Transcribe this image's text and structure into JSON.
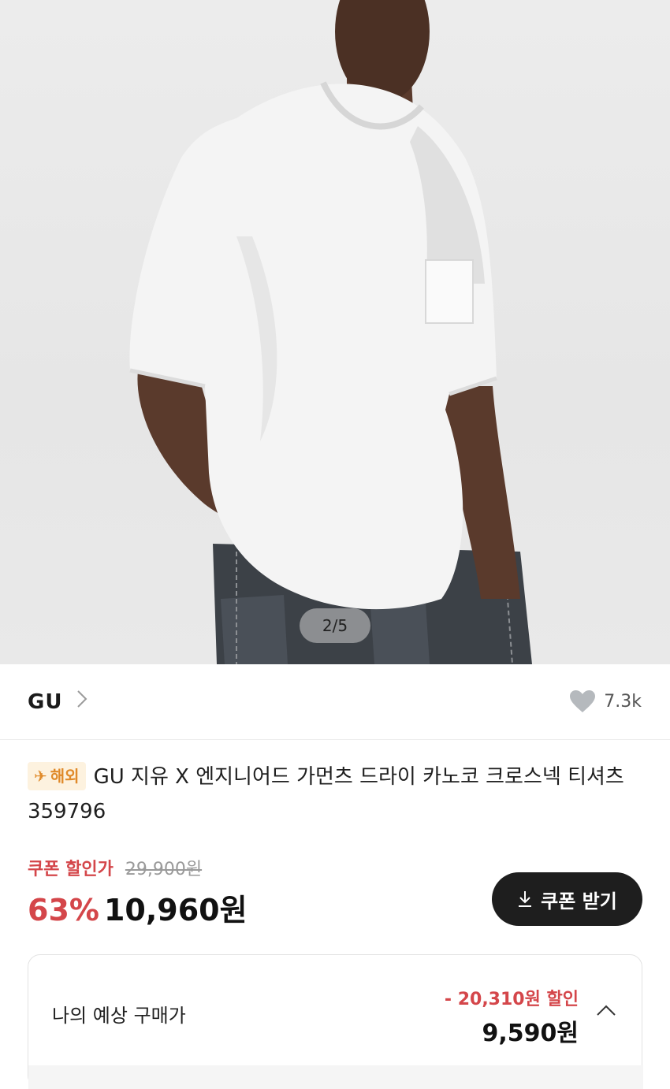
{
  "gallery": {
    "image_alt": "model wearing white crew-neck t-shirt",
    "pager": "2/5"
  },
  "brand": {
    "name": "GU",
    "chevron": "chevron-right-icon"
  },
  "likes": {
    "icon": "heart-icon",
    "count": "7.3k"
  },
  "product": {
    "badge": "해외",
    "badge_icon": "plane-icon",
    "title": "GU 지유 X 엔지니어드 가먼츠 드라이 카노코 크로스넥 티셔츠 359796"
  },
  "pricing": {
    "coupon_label": "쿠폰 할인가",
    "original_price": "29,900원",
    "discount_rate": "63%",
    "sale_price": "10,960원",
    "coupon_button": "쿠폰 받기",
    "coupon_button_icon": "download-icon"
  },
  "estimate": {
    "label": "나의 예상 구매가",
    "discount": "- 20,310원 할인",
    "price": "9,590원",
    "toggle_icon": "chevron-up-icon"
  },
  "colors": {
    "accent_red": "#d4464a",
    "badge_bg": "#fdf2df",
    "badge_text": "#e08a2a",
    "button_bg": "#1e1e1e"
  }
}
